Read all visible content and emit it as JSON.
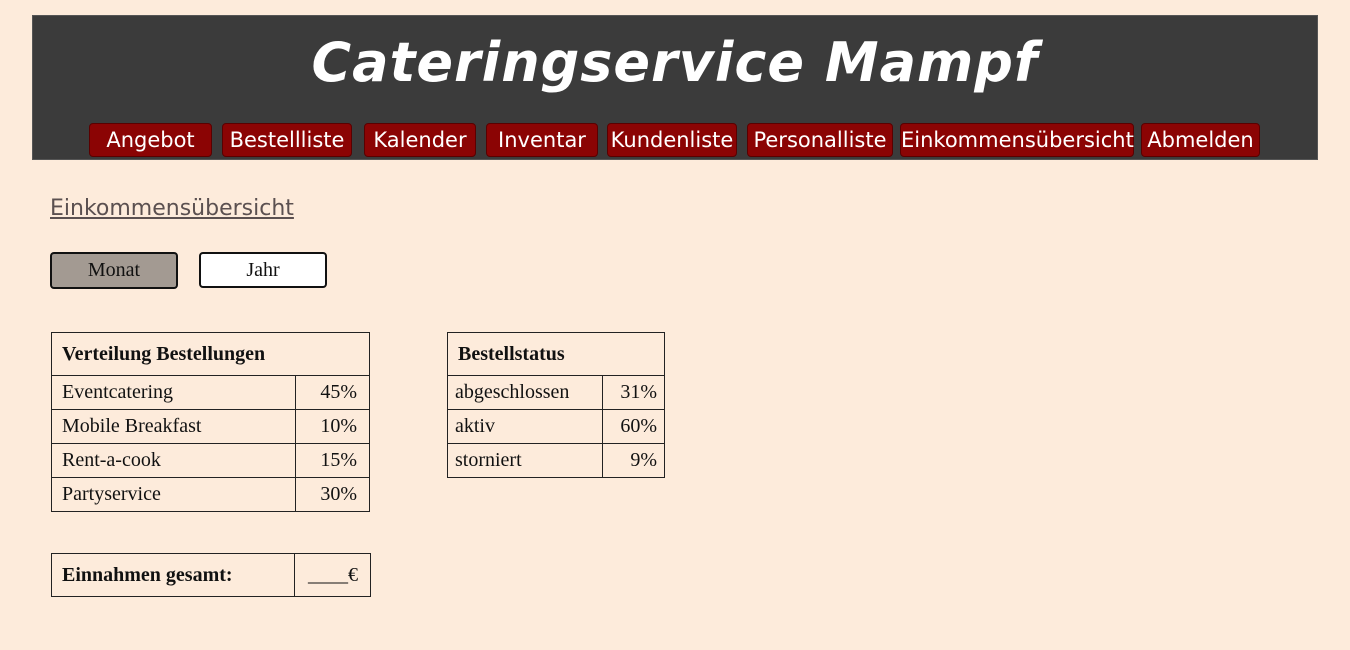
{
  "header": {
    "title": "Cateringservice Mampf",
    "nav": [
      {
        "label": "Angebot"
      },
      {
        "label": "Bestellliste"
      },
      {
        "label": "Kalender"
      },
      {
        "label": "Inventar"
      },
      {
        "label": "Kundenliste"
      },
      {
        "label": "Personalliste"
      },
      {
        "label": "Einkommensübersicht"
      },
      {
        "label": "Abmelden"
      }
    ]
  },
  "main": {
    "page_title": "Einkommensübersicht",
    "period_toggle": {
      "month_label": "Monat",
      "year_label": "Jahr",
      "selected": "Monat"
    },
    "distribution_table": {
      "title": "Verteilung Bestellungen",
      "rows": [
        {
          "label": "Eventcatering",
          "value": "45%"
        },
        {
          "label": "Mobile Breakfast",
          "value": "10%"
        },
        {
          "label": "Rent-a-cook",
          "value": "15%"
        },
        {
          "label": "Partyservice",
          "value": "30%"
        }
      ]
    },
    "status_table": {
      "title": "Bestellstatus",
      "rows": [
        {
          "label": "abgeschlossen",
          "value": "31%"
        },
        {
          "label": "aktiv",
          "value": "60%"
        },
        {
          "label": "storniert",
          "value": "9%"
        }
      ]
    },
    "total_table": {
      "label": "Einnahmen gesamt:",
      "value": "____€"
    }
  },
  "colors": {
    "background": "#fdebdb",
    "header_bg": "#3b3b3b",
    "nav_button": "#8b0404",
    "active_toggle": "#a39a92"
  }
}
